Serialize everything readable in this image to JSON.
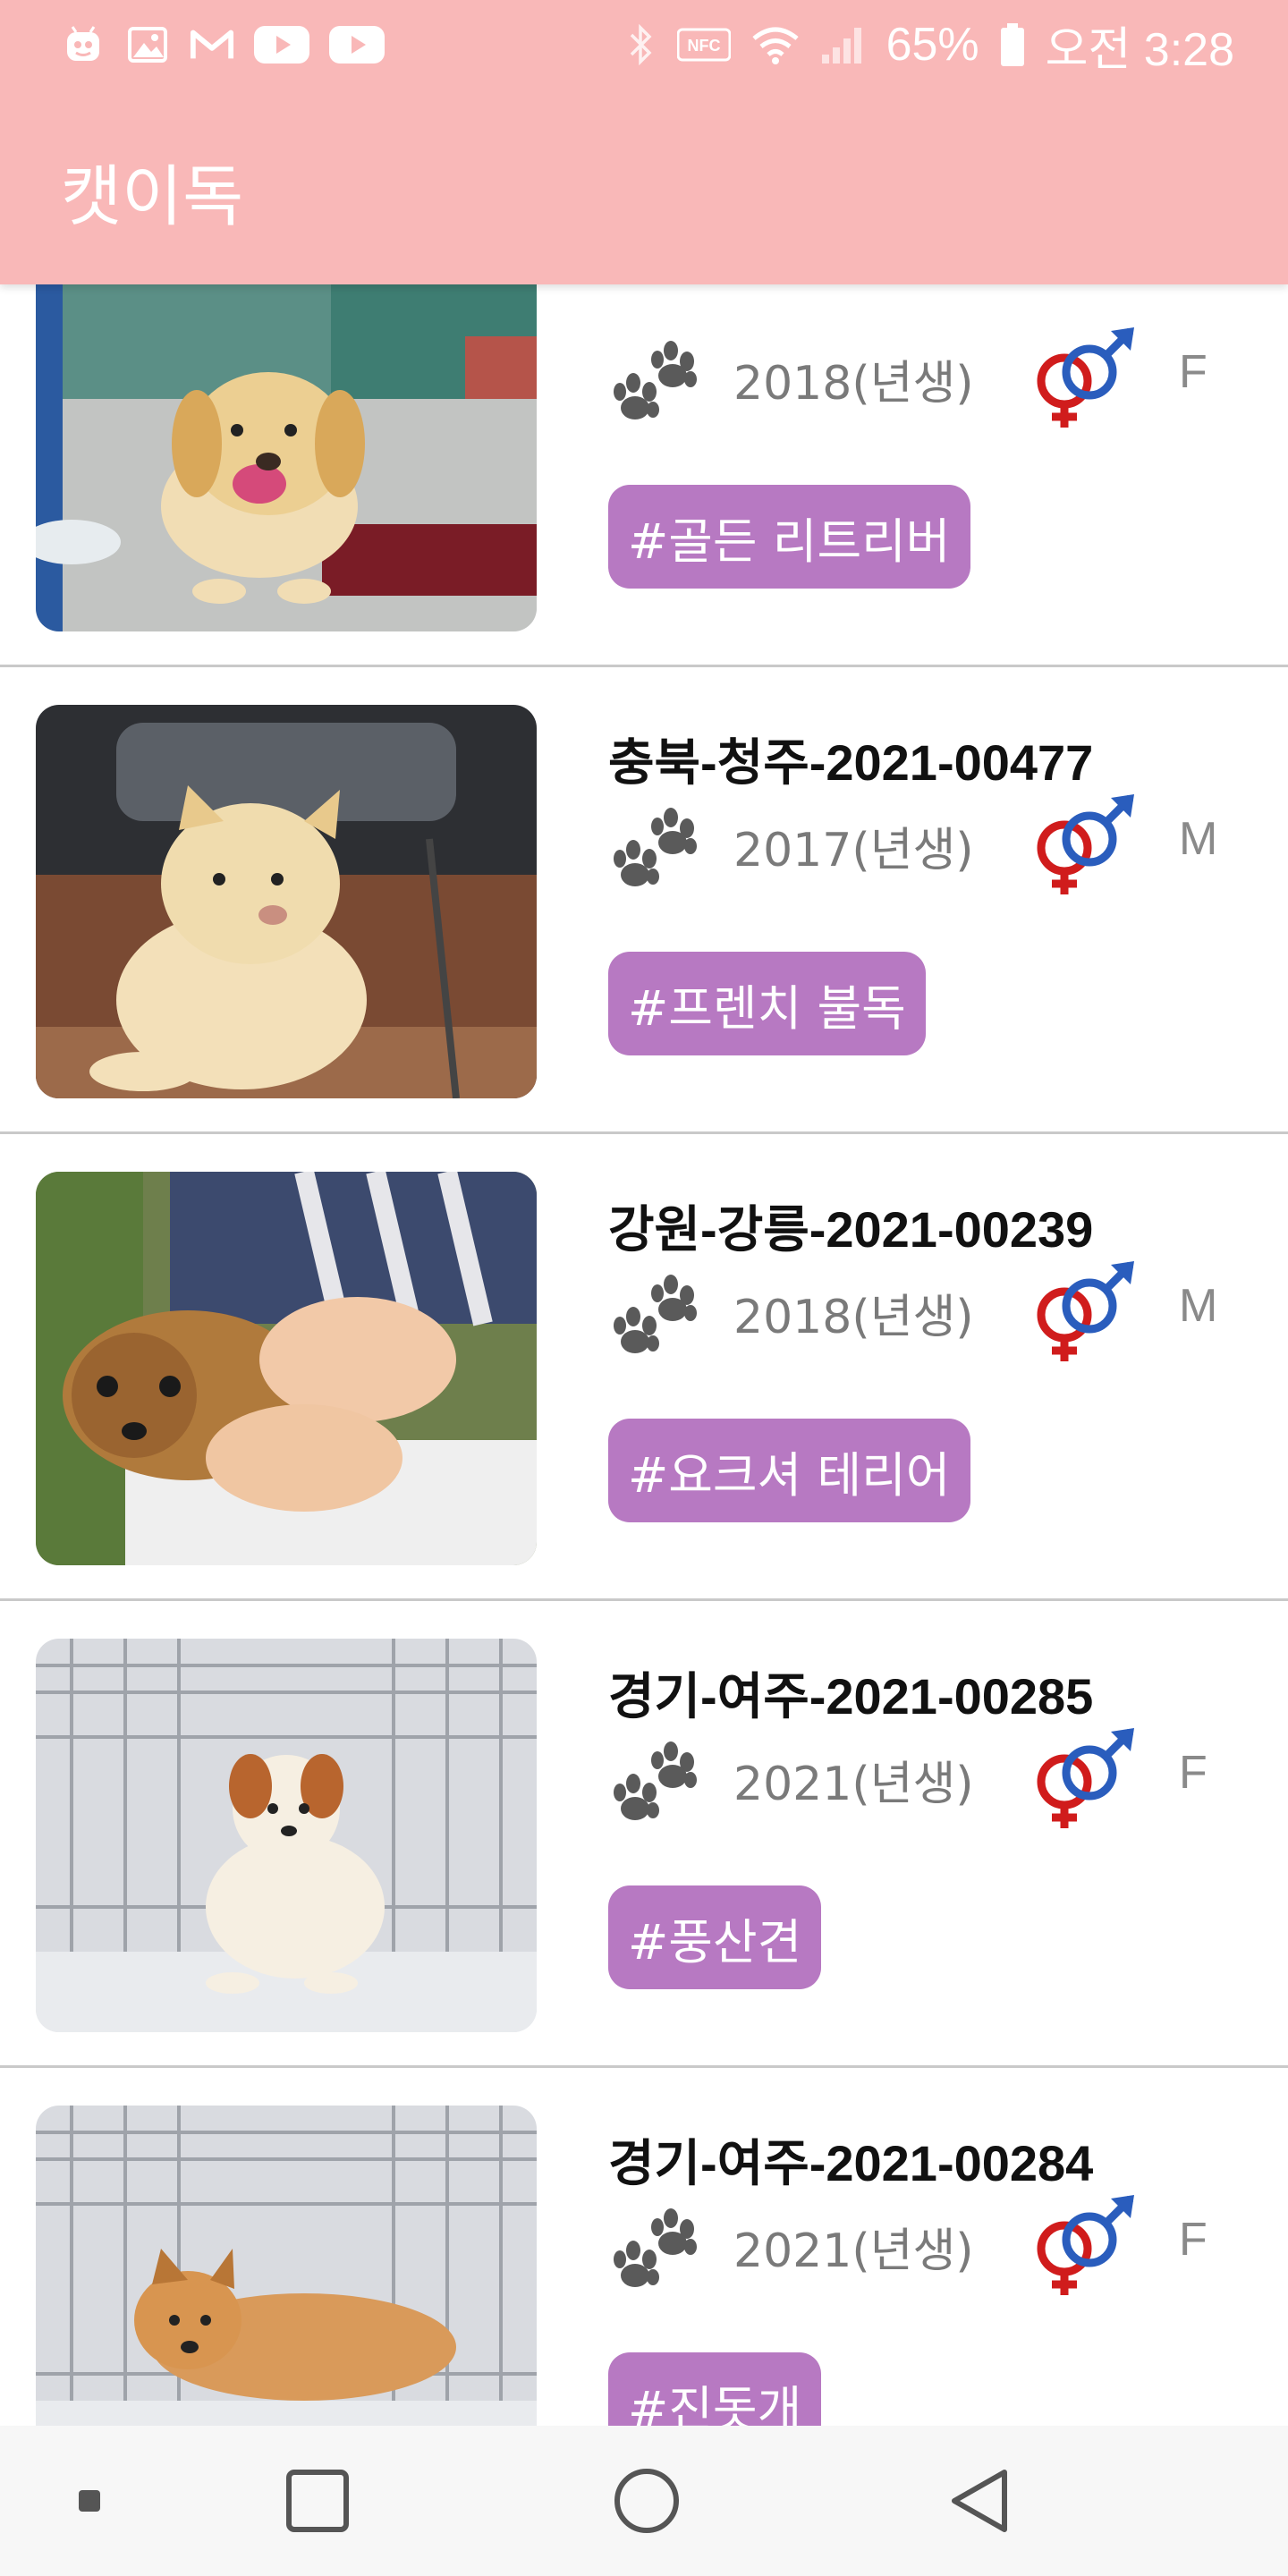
{
  "status_bar": {
    "battery": "65%",
    "time": "오전 3:28",
    "left_icons": [
      "app-icon",
      "gallery-icon",
      "gmail-icon",
      "youtube-icon",
      "youtube-icon"
    ],
    "right_icons": [
      "bluetooth-icon",
      "nfc-icon",
      "wifi-icon",
      "signal-icon",
      "battery-icon"
    ]
  },
  "app_bar": {
    "title": "캣이독"
  },
  "colors": {
    "app_bar": "#f9b8b8",
    "tag": "#b779c2",
    "name_text": "#111111",
    "meta_text": "#7a7a7a"
  },
  "animals": [
    {
      "name": "",
      "birth": "2018(년생)",
      "gender": "F",
      "tag": "#골든 리트리버",
      "photo": "golden-dog-photo"
    },
    {
      "name": "충북-청주-2021-00477",
      "birth": "2017(년생)",
      "gender": "M",
      "tag": "#프렌치 불독",
      "photo": "jindo-dog-photo"
    },
    {
      "name": "강원-강릉-2021-00239",
      "birth": "2018(년생)",
      "gender": "M",
      "tag": "#요크셔 테리어",
      "photo": "yorkie-dog-photo"
    },
    {
      "name": "경기-여주-2021-00285",
      "birth": "2021(년생)",
      "gender": "F",
      "tag": "#풍산견",
      "photo": "puppy-cage-photo"
    },
    {
      "name": "경기-여주-2021-00284",
      "birth": "2021(년생)",
      "gender": "F",
      "tag": "#진돗개",
      "photo": "puppy-cage-photo-2"
    }
  ],
  "nav_bar": [
    "recent-dot",
    "overview-square-icon",
    "home-circle-icon",
    "back-triangle-icon"
  ]
}
